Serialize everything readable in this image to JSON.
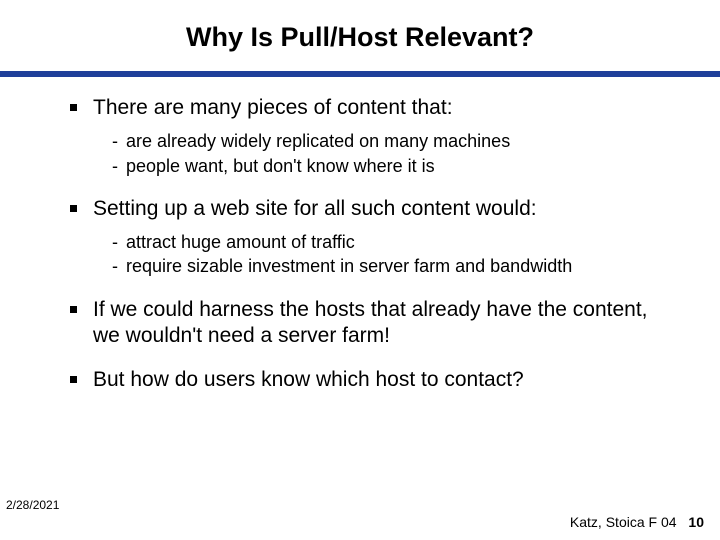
{
  "title": "Why Is Pull/Host Relevant?",
  "points": [
    {
      "text": "There are many pieces of content that:",
      "subs": [
        "are already widely replicated on many machines",
        "people want, but don't know where it is"
      ]
    },
    {
      "text": "Setting up a web site for all such content would:",
      "subs": [
        "attract huge amount of traffic",
        "require sizable investment in server farm and bandwidth"
      ]
    },
    {
      "text": "If we could harness the hosts that already have the content, we wouldn't need a server farm!",
      "subs": []
    },
    {
      "text": "But how do users know which host to contact?",
      "subs": []
    }
  ],
  "footer": {
    "date": "2/28/2021",
    "credit": "Katz, Stoica F 04",
    "page": "10"
  },
  "dash": "-"
}
